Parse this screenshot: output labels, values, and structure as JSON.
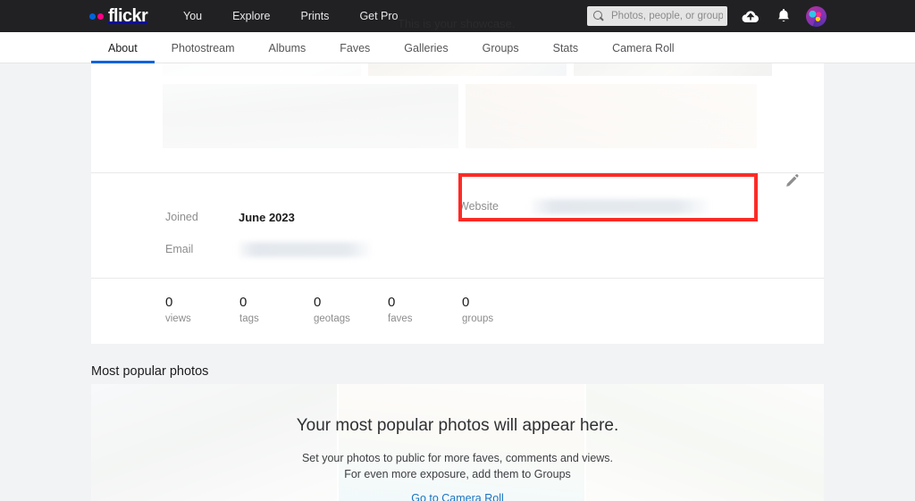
{
  "topbar": {
    "brand": "flickr",
    "nav": [
      {
        "label": "You"
      },
      {
        "label": "Explore"
      },
      {
        "label": "Prints"
      },
      {
        "label": "Get Pro"
      }
    ],
    "showcase_hint": "This is your showcase.",
    "search": {
      "placeholder": "Photos, people, or groups",
      "value": ""
    },
    "icons": {
      "upload": "cloud-upload-icon",
      "notifications": "bell-icon",
      "avatar": "user-avatar"
    },
    "colors": {
      "background": "#212124",
      "dot_blue": "#0063dc",
      "dot_pink": "#ff0084"
    }
  },
  "subnav": {
    "active": "About",
    "items": [
      {
        "label": "About"
      },
      {
        "label": "Photostream"
      },
      {
        "label": "Albums"
      },
      {
        "label": "Faves"
      },
      {
        "label": "Galleries"
      },
      {
        "label": "Groups"
      },
      {
        "label": "Stats"
      },
      {
        "label": "Camera Roll"
      }
    ],
    "active_color": "#0063dc"
  },
  "profile_info": {
    "joined_label": "Joined",
    "joined_value": "June 2023",
    "email_label": "Email",
    "email_value": "",
    "website_label": "Website",
    "website_value": "",
    "edit_icon": "pencil-edit-icon",
    "highlight_color": "#fc2b26"
  },
  "stats": [
    {
      "value": "0",
      "label": "views"
    },
    {
      "value": "0",
      "label": "tags"
    },
    {
      "value": "0",
      "label": "geotags"
    },
    {
      "value": "0",
      "label": "faves"
    },
    {
      "value": "0",
      "label": "groups"
    }
  ],
  "popular": {
    "title": "Most popular photos",
    "heading": "Your most popular photos will appear here.",
    "sub1": "Set your photos to public for more faves, comments and views.",
    "sub2": "For even more exposure, add them to Groups",
    "link": "Go to Camera Roll",
    "link_color": "#1a73c2"
  }
}
